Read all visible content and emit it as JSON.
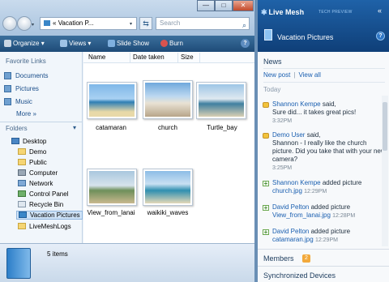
{
  "explorer": {
    "address": "Vacation P...",
    "address_prefix": "«",
    "search_placeholder": "Search",
    "window_controls": {
      "minimize": "—",
      "maximize": "□",
      "close": "✕"
    },
    "toolbar": {
      "organize": "Organize",
      "views": "Views",
      "slideshow": "Slide Show",
      "burn": "Burn",
      "help": "?"
    },
    "nav": {
      "favorites_title": "Favorite Links",
      "favorites": [
        "Documents",
        "Pictures",
        "Music"
      ],
      "more": "More",
      "more_chevron": "»",
      "folders_title": "Folders",
      "folders_chevron": "▾",
      "tree": [
        "Desktop",
        "Demo",
        "Public",
        "Computer",
        "Network",
        "Control Panel",
        "Recycle Bin",
        "Vacation Pictures",
        "LiveMeshLogs"
      ]
    },
    "columns": [
      "Name",
      "Date taken",
      "Size"
    ],
    "files": [
      "catamaran",
      "church",
      "Turtle_bay",
      "View_from_lanai",
      "waikiki_waves"
    ],
    "status": "5 items"
  },
  "mesh": {
    "logo": "Live Mesh",
    "preview": "TECH PREVIEW",
    "collapse": "«",
    "folder_title": "Vacation Pictures",
    "help": "?",
    "news_title": "News",
    "new_post": "New post",
    "view_all": "View all",
    "today": "Today",
    "feed": [
      {
        "who": "Shannon Kempe",
        "verb": "said,",
        "text": "Sure did... it takes great pics!",
        "time": "3:32PM"
      },
      {
        "who": "Demo User",
        "verb": "said,",
        "text": "Shannon - I really like the church picture. Did you take that with your new camera?",
        "time": "3:25PM"
      },
      {
        "who": "Shannon Kempe",
        "verb": "added picture",
        "file": "church.jpg",
        "time": "12:29PM"
      },
      {
        "who": "David Pelton",
        "verb": "added picture",
        "file": "View_from_lanai.jpg",
        "time": "12:28PM"
      },
      {
        "who": "David Pelton",
        "verb": "added picture",
        "file": "catamaran.jpg",
        "time": "12:29PM"
      }
    ],
    "members_label": "Members",
    "members_badge": "2",
    "synced_label": "Synchronized Devices"
  }
}
